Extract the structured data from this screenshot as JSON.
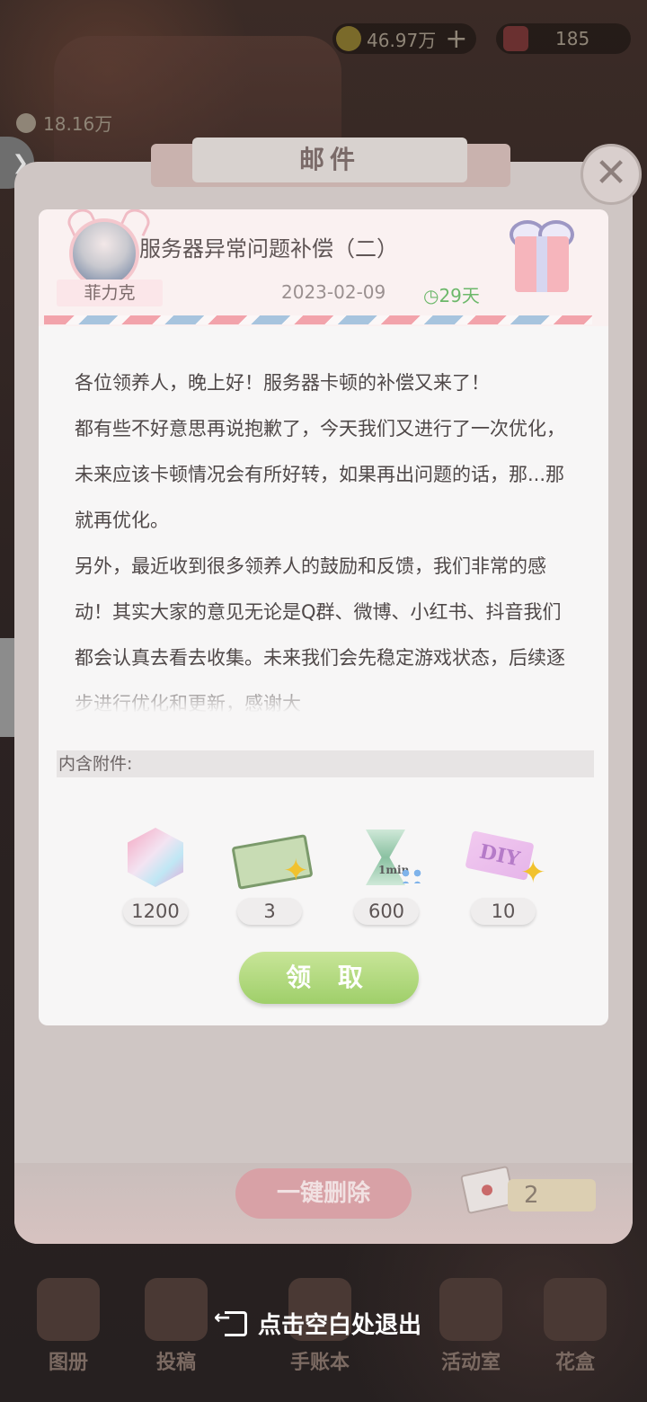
{
  "hud": {
    "coins": "46.97万",
    "gems": "185",
    "fans": "18.16万"
  },
  "mail_window": {
    "title": "邮件",
    "close_label": "✕",
    "delete_all_label": "一键删除",
    "mail_count": "2"
  },
  "letter": {
    "sender": "菲力克",
    "subject": "服务器异常问题补偿（二）",
    "date": "2023-02-09",
    "days_left": "29天",
    "body": [
      "各位领养人，晚上好！服务器卡顿的补偿又来了！",
      "都有些不好意思再说抱歉了，今天我们又进行了一次优化，未来应该卡顿情况会有所好转，如果再出问题的话，那...那就再优化。",
      "另外，最近收到很多领养人的鼓励和反馈，我们非常的感动！其实大家的意见无论是Q群、微博、小红书、抖音我们都会认真去看去收集。未来我们会先稳定游戏状态，后续逐步进行优化和更新，感谢大"
    ],
    "attachments_label": "内含附件:",
    "attachments": [
      {
        "name": "gem",
        "icon": "crystal-gem-icon",
        "count": "1200"
      },
      {
        "name": "ticket",
        "icon": "train-ticket-icon",
        "count": "3"
      },
      {
        "name": "hourglass",
        "icon": "hourglass-icon",
        "count": "600",
        "icon_text": "1min"
      },
      {
        "name": "diy-card",
        "icon": "diy-card-icon",
        "count": "10",
        "icon_text": "DIY"
      }
    ],
    "claim_label": "领 取"
  },
  "bottom_nav": [
    {
      "label": "图册"
    },
    {
      "label": "投稿"
    },
    {
      "label": "手账本"
    },
    {
      "label": "活动室"
    },
    {
      "label": "花盒"
    }
  ],
  "exit_hint": "点击空白处退出",
  "colors": {
    "accent_green": "#9fcf6a",
    "days_green": "#6cb86a",
    "delete_pink": "#d8a1a6"
  }
}
